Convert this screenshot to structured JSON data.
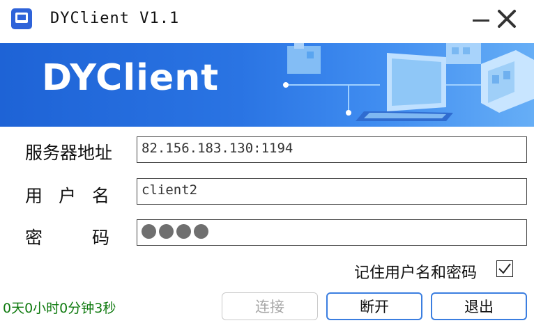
{
  "window": {
    "title": "DYClient V1.1",
    "icon": "vpn-app-icon",
    "controls": [
      "minimize-icon",
      "close-icon"
    ]
  },
  "banner": {
    "title": "DYClient",
    "illustration": "buildings-laptop-network-icon"
  },
  "form": {
    "server_label": "服务器地址",
    "server_value": "82.156.183.130:1194",
    "username_label_chars": [
      "用",
      "户",
      "名"
    ],
    "username_value": "client2",
    "password_label_chars": [
      "密",
      "码"
    ],
    "password_mask_count": 4,
    "remember_label": "记住用户名和密码",
    "remember_checked": true
  },
  "status": {
    "uptime": "0天0小时0分钟3秒"
  },
  "buttons": {
    "connect": "连接",
    "disconnect": "断开",
    "exit": "退出"
  },
  "colors": {
    "banner": "#2a74e3",
    "status_text": "#0f7a0f",
    "button_border": "#3b7ee0",
    "disabled_text": "#a8a8a8"
  }
}
